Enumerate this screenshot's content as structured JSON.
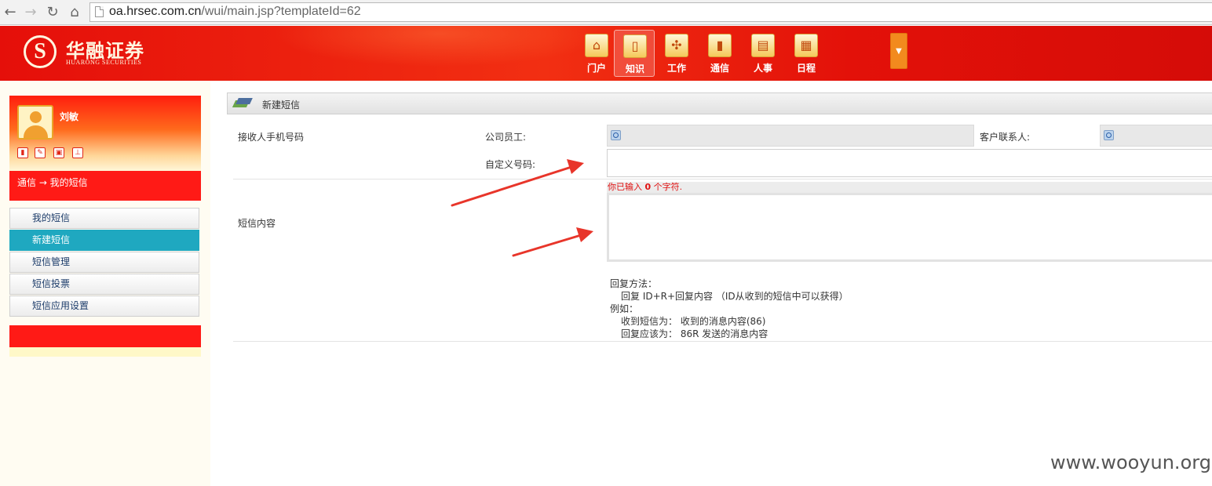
{
  "browser": {
    "url_host": "oa.hrsec.com.cn",
    "url_path": "/wui/main.jsp?templateId=62",
    "back_icon": "back-arrow-icon",
    "forward_icon": "forward-arrow-icon",
    "reload_icon": "reload-icon",
    "home_icon": "home-icon"
  },
  "header": {
    "logo_cn": "华融证券",
    "logo_en": "HUARONG SECURITIES",
    "nav": [
      {
        "label": "门户",
        "icon": "house-icon",
        "glyph": "⌂"
      },
      {
        "label": "知识",
        "icon": "book-icon",
        "glyph": "▯"
      },
      {
        "label": "工作",
        "icon": "grid-icon",
        "glyph": "✣"
      },
      {
        "label": "通信",
        "icon": "phone-icon",
        "glyph": "▮"
      },
      {
        "label": "人事",
        "icon": "document-icon",
        "glyph": "▤"
      },
      {
        "label": "日程",
        "icon": "calendar-icon",
        "glyph": "▦"
      }
    ],
    "active_nav": "知识",
    "brand_color": "#e31109"
  },
  "sidebar": {
    "user_name": "刘敏",
    "breadcrumb": "通信 → 我的短信",
    "menu": [
      {
        "label": "我的短信"
      },
      {
        "label": "新建短信"
      },
      {
        "label": "短信管理"
      },
      {
        "label": "短信投票"
      },
      {
        "label": "短信应用设置"
      }
    ],
    "active_menu": "新建短信"
  },
  "main": {
    "title": "新建短信",
    "recipient_label": "接收人手机号码",
    "employee_label": "公司员工:",
    "contact_label": "客户联系人:",
    "custom_label": "自定义号码:",
    "content_label": "短信内容",
    "counter_prefix": "你已输入",
    "counter_value": "0",
    "counter_suffix": "个字符.",
    "help": {
      "line1": "回复方法：",
      "line2": "回复 ID+R+回复内容 （ID从收到的短信中可以获得）",
      "line3": "例如：",
      "line4": "收到短信为： 收到的消息内容(86)",
      "line5": "回复应该为： 86R 发送的消息内容"
    }
  },
  "watermark": "www.wooyun.org"
}
